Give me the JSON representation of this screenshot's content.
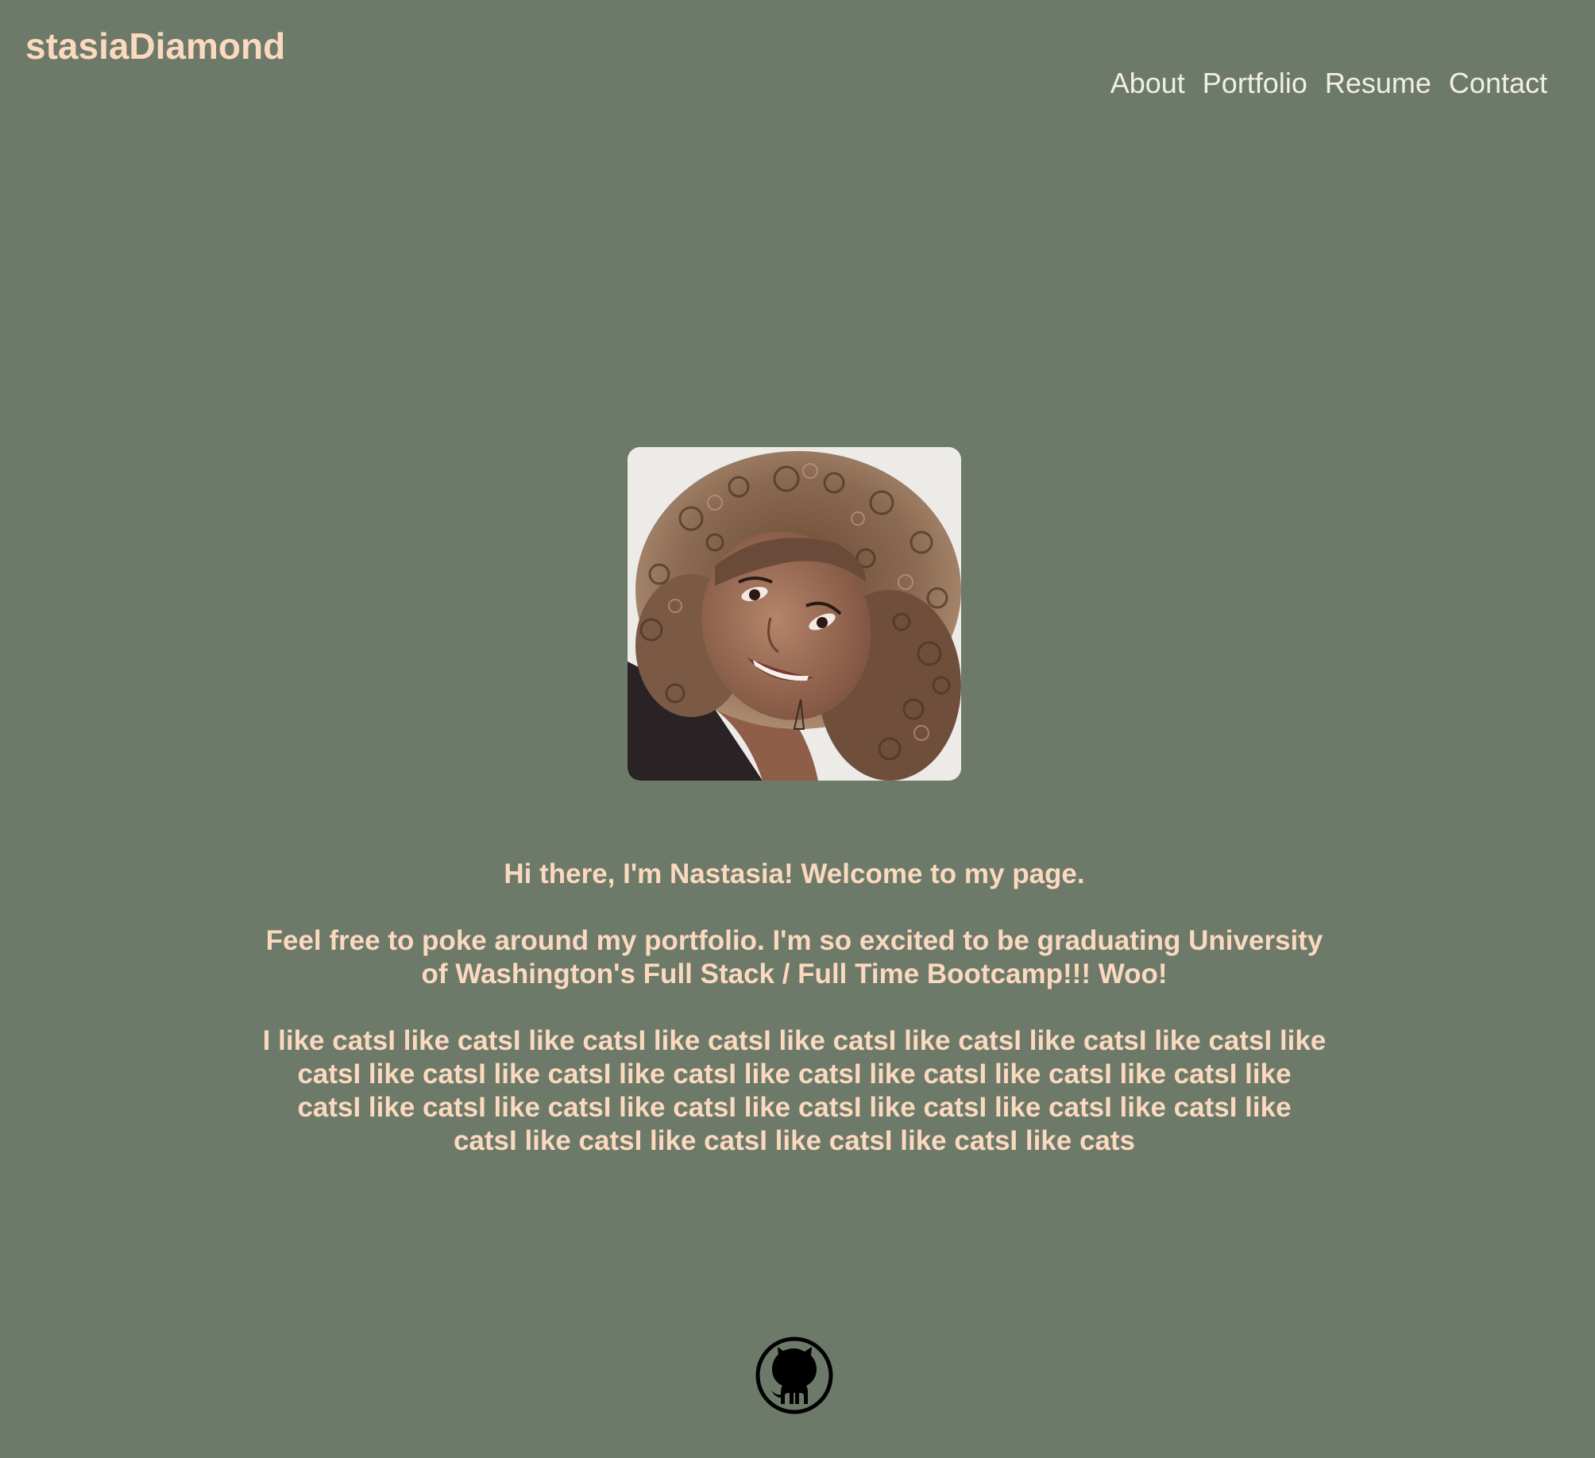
{
  "header": {
    "brand": "stasiaDiamond",
    "nav": [
      "About",
      "Portfolio",
      "Resume",
      "Contact"
    ]
  },
  "profile": {
    "photo_alt": "Portrait of Nastasia"
  },
  "bio": {
    "greeting": "Hi there, I'm Nastasia! Welcome to my page.",
    "intro": "Feel free to poke around my portfolio. I'm so excited to be graduating University of Washington's Full Stack / Full Time Bootcamp!!! Woo!",
    "cats": "I like catsI like catsI like catsI like catsI like catsI like catsI like catsI like catsI like catsI like catsI like catsI like catsI like catsI like catsI like catsI like catsI like catsI like catsI like catsI like catsI like catsI like catsI like catsI like catsI like catsI like catsI like catsI like catsI like catsI like cats"
  },
  "footer": {
    "icon": "github-icon"
  },
  "colors": {
    "background": "#6d7a69",
    "accent": "#fbd9bf",
    "nav_text": "#f2eee9",
    "icon": "#000000"
  }
}
